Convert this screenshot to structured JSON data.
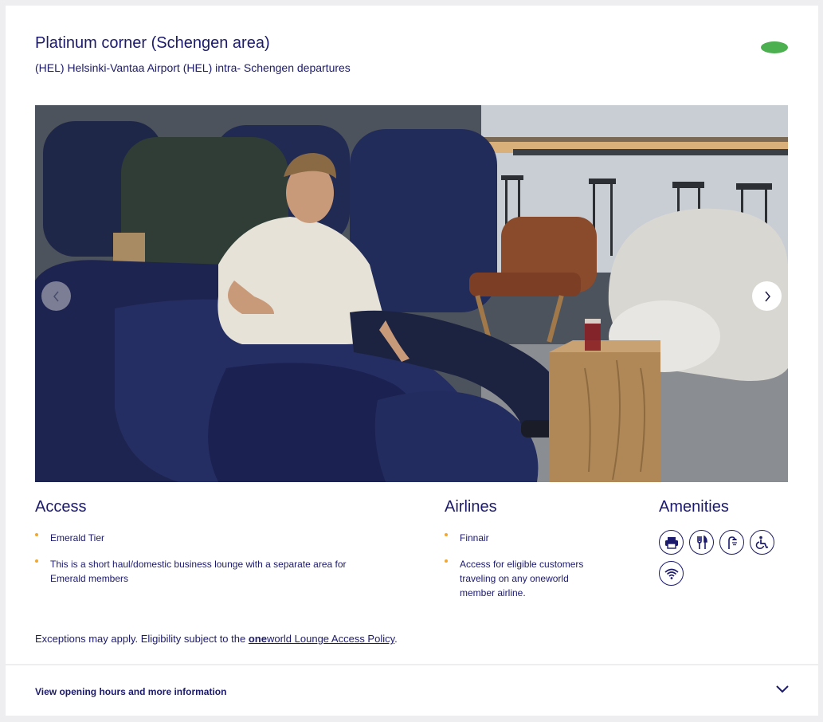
{
  "lounge": {
    "title": "Platinum corner (Schengen area)",
    "subtitle": "(HEL) Helsinki-Vantaa Airport (HEL) intra- Schengen departures",
    "status_color": "#4caf50"
  },
  "carousel": {
    "prev_icon": "chevron-left-icon",
    "next_icon": "chevron-right-icon"
  },
  "access": {
    "heading": "Access",
    "items": [
      "Emerald Tier",
      "This is a short haul/domestic business lounge with a separate area for Emerald members"
    ]
  },
  "airlines": {
    "heading": "Airlines",
    "items": [
      "Finnair",
      "Access for eligible customers traveling on any oneworld member airline."
    ]
  },
  "amenities": {
    "heading": "Amenities",
    "icons": [
      "printer-icon",
      "dining-icon",
      "shower-icon",
      "wheelchair-icon",
      "wifi-icon"
    ]
  },
  "exceptions": {
    "prefix": "Exceptions may apply. Eligibility subject to the ",
    "link_bold": "one",
    "link_rest": "world Lounge Access Policy",
    "suffix": "."
  },
  "footer": {
    "label": "View opening hours and more information",
    "icon": "chevron-down-icon"
  },
  "colors": {
    "brand_navy": "#1c1a6c",
    "bullet": "#f0a830",
    "status": "#4caf50"
  }
}
